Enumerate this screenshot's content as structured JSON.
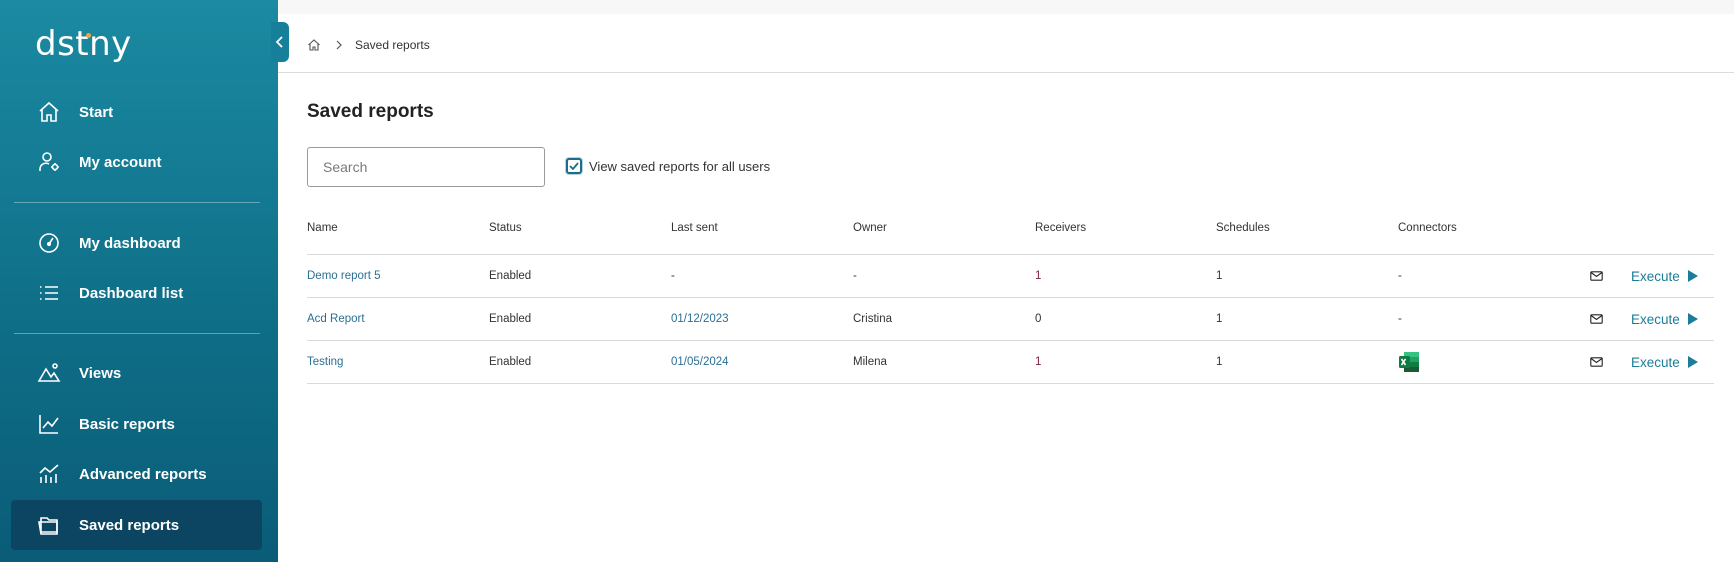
{
  "brand": {
    "logo_text": "dstny",
    "accent_color": "#f2a33a",
    "sidebar_color": "#0f6f88",
    "active_color": "#0b4561"
  },
  "sidebar": {
    "items": [
      {
        "label": "Start",
        "icon": "home-icon"
      },
      {
        "label": "My account",
        "icon": "user-settings-icon"
      },
      {
        "label": "My dashboard",
        "icon": "gauge-icon"
      },
      {
        "label": "Dashboard list",
        "icon": "list-icon"
      },
      {
        "label": "Views",
        "icon": "mountain-icon"
      },
      {
        "label": "Basic reports",
        "icon": "line-chart-icon"
      },
      {
        "label": "Advanced reports",
        "icon": "bar-line-chart-icon"
      },
      {
        "label": "Saved reports",
        "icon": "folder-icon",
        "active": true
      }
    ]
  },
  "breadcrumb": {
    "current": "Saved reports"
  },
  "page": {
    "title": "Saved reports"
  },
  "search": {
    "placeholder": "Search"
  },
  "filter": {
    "label": "View saved reports for all users",
    "checked": true
  },
  "table": {
    "headers": [
      "Name",
      "Status",
      "Last sent",
      "Owner",
      "Receivers",
      "Schedules",
      "Connectors"
    ],
    "rows": [
      {
        "name": "Demo report 5",
        "status": "Enabled",
        "last_sent": "-",
        "owner": "-",
        "receivers": "1",
        "schedules": "1",
        "connectors": "-",
        "action": "Execute"
      },
      {
        "name": "Acd Report",
        "status": "Enabled",
        "last_sent": "01/12/2023",
        "owner": "Cristina",
        "receivers": "0",
        "schedules": "1",
        "connectors": "-",
        "action": "Execute"
      },
      {
        "name": "Testing",
        "status": "Enabled",
        "last_sent": "01/05/2024",
        "owner": "Milena",
        "receivers": "1",
        "schedules": "1",
        "connectors": "excel-icon",
        "action": "Execute"
      }
    ]
  }
}
